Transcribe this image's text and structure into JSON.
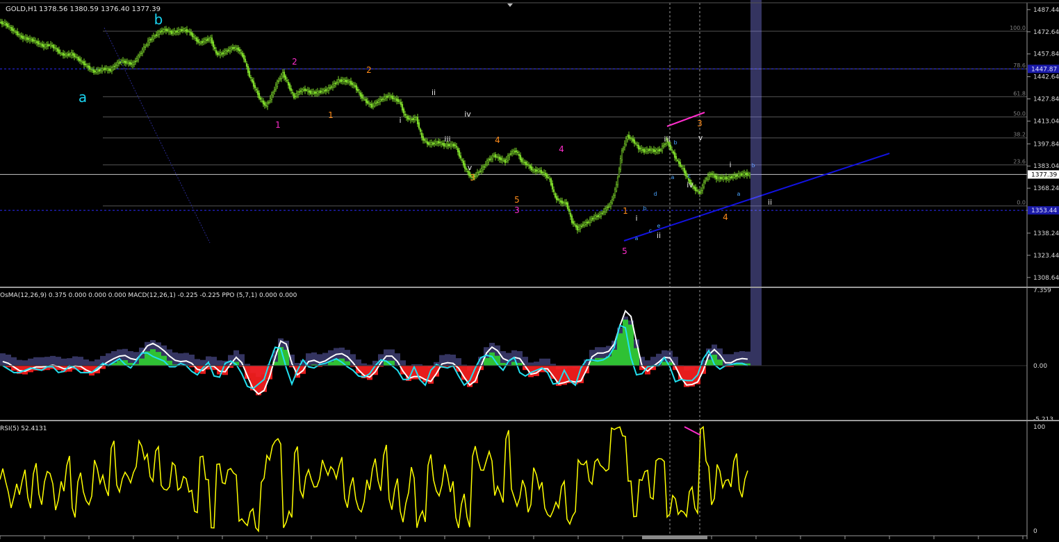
{
  "header": {
    "symbol_label": "GOLD,H1",
    "ohlc": "1378.56 1380.59 1376.40 1377.39"
  },
  "indicators": {
    "macd_label": "OsMA(12,26,9) 0.375 0.000 0.000 0.000   MACD(12,26,1) -0.225 -0.225   PPO (5,7,1) 0.000 0.000",
    "rsi_label": "RSI(5) 52.4131"
  },
  "price_axis": {
    "ticks": [
      "1487.44",
      "1472.64",
      "1457.84",
      "1442.64",
      "1427.84",
      "1413.04",
      "1397.84",
      "1383.04",
      "1368.24",
      "1353.44",
      "1338.24",
      "1323.44",
      "1308.64"
    ],
    "current_price": "1377.39",
    "line_tags": [
      "1447.87",
      "1353.44"
    ]
  },
  "macd_axis": {
    "ticks": [
      "7.359",
      "0.00",
      "-5.213"
    ]
  },
  "rsi_axis": {
    "ticks": [
      "100",
      "0"
    ]
  },
  "fib_labels": [
    "100.0",
    "78.6",
    "61.8",
    "50.0",
    "38.2",
    "23.6",
    "0.0"
  ],
  "wave_labels": {
    "cyan_large": [
      "a",
      "b"
    ],
    "magenta": [
      "1",
      "2",
      "3",
      "4",
      "5"
    ],
    "orange": [
      "1",
      "2",
      "3",
      "4",
      "5",
      "1",
      "3",
      "4"
    ],
    "roman": [
      "i",
      "ii",
      "iii",
      "iv",
      "v",
      "i",
      "ii",
      "iii",
      "iv",
      "v",
      "i",
      "ii"
    ],
    "small_blue": [
      "a",
      "b",
      "c",
      "d",
      "e",
      "a",
      "b",
      "c",
      "a",
      "b"
    ]
  },
  "colors": {
    "background": "#000000",
    "candle": "#7cd62a",
    "fib_line": "#555555",
    "trend_line": "#1212e0",
    "magenta": "#ff2dcc",
    "orange": "#ff8c1a",
    "cyan": "#19d3f0",
    "rsi": "#ffff00",
    "macd_signal": "#ffffff",
    "macd_main": "#22e0f0",
    "hist_pos": "#2fd02f",
    "hist_neg": "#ff1f1f",
    "ppo_bar": "#8a8aff"
  },
  "chart_data": {
    "type": "line",
    "symbol": "GOLD",
    "timeframe": "H1",
    "x": [
      0,
      8,
      16,
      24,
      32,
      40,
      48,
      56,
      64,
      72,
      80,
      88,
      96,
      104,
      112,
      120,
      128,
      136,
      144,
      152,
      160,
      168,
      176,
      184,
      192,
      200,
      208,
      216,
      224,
      232,
      240,
      248,
      256,
      264,
      272,
      280,
      288,
      296,
      304,
      312,
      320,
      328,
      336,
      344,
      352,
      360,
      368,
      376,
      384,
      392,
      400,
      408,
      416,
      424,
      432,
      440,
      448,
      456,
      464,
      472,
      480,
      488,
      496,
      504,
      512,
      520,
      528,
      536,
      544,
      552,
      560,
      568,
      576,
      584,
      592,
      600,
      608,
      616,
      624,
      632,
      640,
      648,
      656,
      664,
      672,
      680,
      688,
      696,
      704,
      712,
      720,
      728,
      736,
      744,
      752,
      760,
      768,
      776,
      784,
      792,
      800,
      808,
      816,
      824,
      832,
      840,
      848,
      856,
      864,
      872,
      880,
      888,
      896,
      904,
      912,
      920,
      928,
      936,
      944,
      952,
      960,
      968,
      976,
      984,
      992,
      1000,
      1008,
      1016,
      1024,
      1032,
      1040,
      1048,
      1056,
      1064,
      1072,
      1080,
      1088
    ],
    "series": [
      {
        "values": [
          1478,
          1475,
          1472,
          1469,
          1468,
          1467,
          1465,
          1463,
          1464,
          1462,
          1458,
          1457,
          1458,
          1455,
          1452,
          1449,
          1446,
          1447,
          1448,
          1447,
          1451,
          1453,
          1452,
          1451,
          1456,
          1462,
          1467,
          1470,
          1473,
          1474,
          1472,
          1473,
          1474,
          1473,
          1469,
          1465,
          1467,
          1468,
          1458,
          1458,
          1460,
          1462,
          1461,
          1455,
          1443,
          1435,
          1427,
          1423,
          1430,
          1439,
          1445,
          1437,
          1429,
          1433,
          1434,
          1432,
          1432,
          1433,
          1434,
          1437,
          1440,
          1440,
          1439,
          1436,
          1430,
          1426,
          1423,
          1426,
          1428,
          1430,
          1428,
          1426,
          1416,
          1414,
          1415,
          1402,
          1398,
          1398,
          1399,
          1397,
          1397,
          1397,
          1388,
          1380,
          1375,
          1378,
          1382,
          1387,
          1390,
          1388,
          1386,
          1392,
          1393,
          1386,
          1384,
          1380,
          1380,
          1378,
          1374,
          1362,
          1359,
          1358,
          1346,
          1341,
          1344,
          1346,
          1349,
          1350,
          1354,
          1358,
          1370,
          1393,
          1403,
          1400,
          1395,
          1393,
          1394,
          1393,
          1394,
          1400,
          1393,
          1386,
          1381,
          1373,
          1368,
          1365,
          1374,
          1378,
          1375,
          1375,
          1375,
          1376,
          1377,
          1378,
          1377
        ]
      }
    ],
    "ylim": [
      1303,
      1492
    ]
  }
}
